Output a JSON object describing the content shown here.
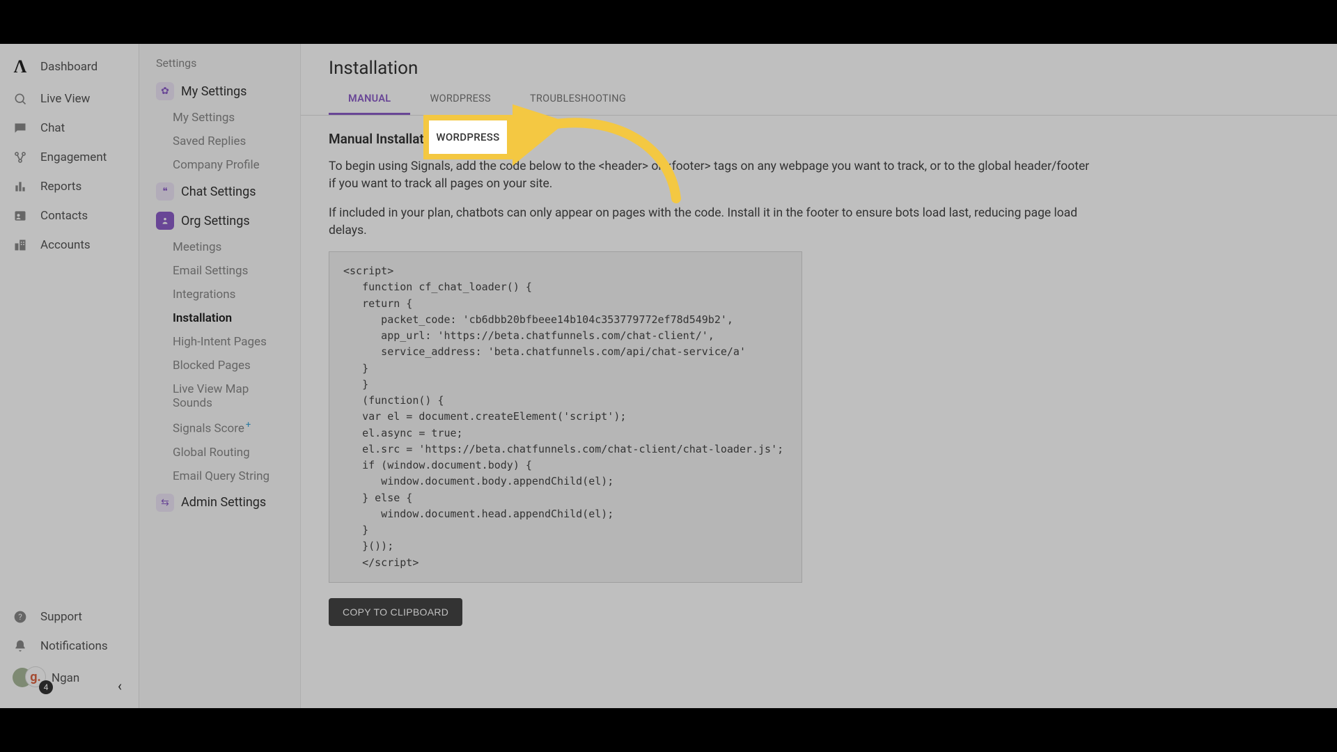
{
  "nav1": {
    "items": [
      {
        "label": "Dashboard",
        "icon": "logo"
      },
      {
        "label": "Live View",
        "icon": "liveview"
      },
      {
        "label": "Chat",
        "icon": "chat"
      },
      {
        "label": "Engagement",
        "icon": "engagement"
      },
      {
        "label": "Reports",
        "icon": "reports"
      },
      {
        "label": "Contacts",
        "icon": "contacts"
      },
      {
        "label": "Accounts",
        "icon": "accounts"
      }
    ],
    "support": "Support",
    "notifications": "Notifications",
    "user": {
      "name": "Ngan",
      "initial": "g.",
      "badge": "4"
    }
  },
  "nav2": {
    "heading": "Settings",
    "sections": [
      {
        "label": "My Settings",
        "subs": [
          {
            "label": "My Settings"
          },
          {
            "label": "Saved Replies"
          },
          {
            "label": "Company Profile"
          }
        ]
      },
      {
        "label": "Chat Settings",
        "subs": []
      },
      {
        "label": "Org Settings",
        "subs": [
          {
            "label": "Meetings"
          },
          {
            "label": "Email Settings"
          },
          {
            "label": "Integrations"
          },
          {
            "label": "Installation",
            "active": true
          },
          {
            "label": "High-Intent Pages"
          },
          {
            "label": "Blocked Pages"
          },
          {
            "label": "Live View Map Sounds"
          },
          {
            "label": "Signals Score",
            "sup": "+"
          },
          {
            "label": "Global Routing"
          },
          {
            "label": "Email Query String"
          }
        ]
      },
      {
        "label": "Admin Settings",
        "subs": []
      }
    ]
  },
  "main": {
    "title": "Installation",
    "tabs": [
      {
        "label": "MANUAL",
        "active": true
      },
      {
        "label": "WORDPRESS"
      },
      {
        "label": "TROUBLESHOOTING"
      }
    ],
    "section_heading": "Manual Installation",
    "para1": "To begin using Signals, add the code below to the <header> or <footer> tags on any webpage you want to track, or to the global header/footer if you want to track all pages on your site.",
    "para2": "If included in your plan, chatbots can only appear on pages with the code. Install it in the footer to ensure bots load last, reducing page load delays.",
    "code": "<script>\n   function cf_chat_loader() {\n   return {\n      packet_code: 'cb6dbb20bfbeee14b104c353779772ef78d549b2',\n      app_url: 'https://beta.chatfunnels.com/chat-client/',\n      service_address: 'beta.chatfunnels.com/api/chat-service/a'\n   }\n   }\n   (function() {\n   var el = document.createElement('script');\n   el.async = true;\n   el.src = 'https://beta.chatfunnels.com/chat-client/chat-loader.js';\n   if (window.document.body) {\n      window.document.body.appendChild(el);\n   } else {\n      window.document.head.appendChild(el);\n   }\n   }());\n   </script>",
    "copy_btn": "COPY TO CLIPBOARD"
  },
  "annotation": {
    "highlight_tab": "WORDPRESS"
  }
}
